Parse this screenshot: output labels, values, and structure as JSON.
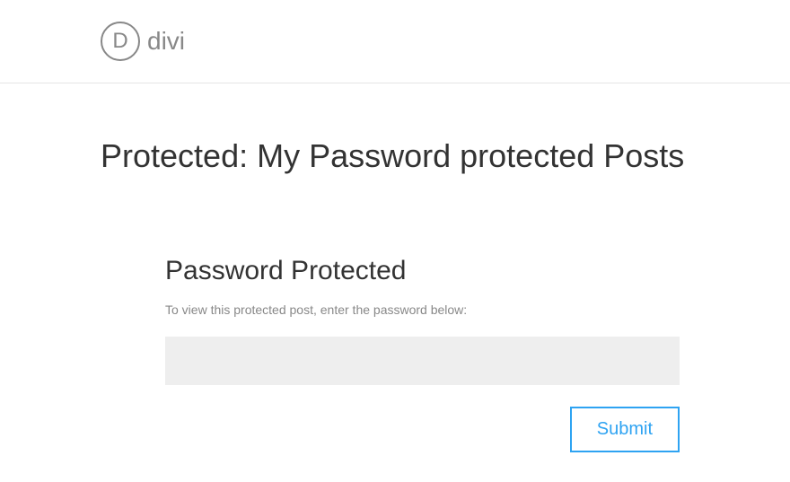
{
  "header": {
    "logo_letter": "D",
    "logo_text": "divi"
  },
  "main": {
    "page_title": "Protected: My Password protected Posts",
    "password_form": {
      "title": "Password Protected",
      "instruction": "To view this protected post, enter the password below:",
      "input_value": "",
      "submit_label": "Submit"
    }
  },
  "colors": {
    "accent": "#2ea3f2",
    "text_muted": "#888",
    "text": "#333",
    "input_bg": "#eeeeee"
  }
}
